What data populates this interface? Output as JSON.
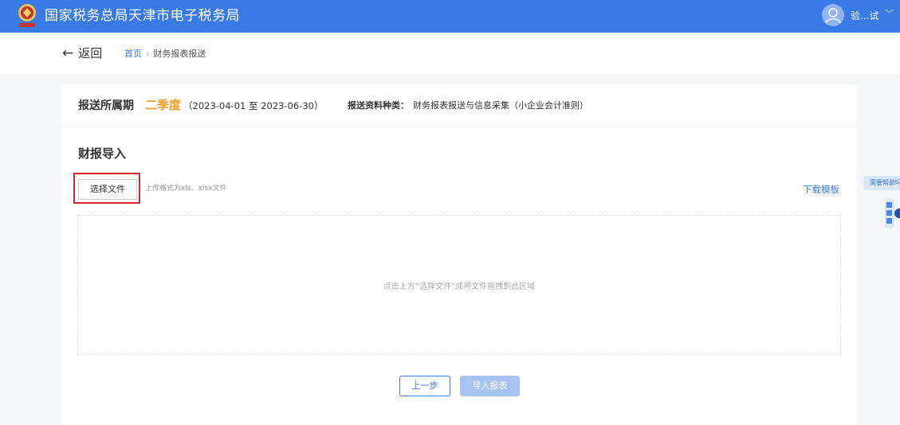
{
  "header": {
    "title": "国家税务总局天津市电子税务局",
    "user_name": "验...试",
    "user_menu_icon": "chevron-down-icon",
    "brand_color": "#3a7ae4"
  },
  "nav": {
    "back_label": "返回",
    "breadcrumb": {
      "home": "首页",
      "separator": "›",
      "current": "财务报表报送"
    }
  },
  "period": {
    "label": "报送所属期",
    "quarter": "二季度",
    "range": "（2023-04-01 至 2023-06-30）",
    "type_label": "报送资料种类：",
    "type_value": "财务报表报送与信息采集（小企业会计准则）",
    "quarter_color": "#f59a23"
  },
  "import": {
    "title": "财报导入",
    "choose_file_label": "选择文件",
    "upload_hint": "上传格式为xls、xlsx文件",
    "download_template_label": "下载模板",
    "dropzone_text": "点击上方“选择文件”或将文件拖拽到此区域",
    "highlight_color": "#d9262c"
  },
  "actions": {
    "prev_label": "上一步",
    "import_label": "导入报表"
  },
  "side": {
    "help_label": "需要帮助吗"
  }
}
